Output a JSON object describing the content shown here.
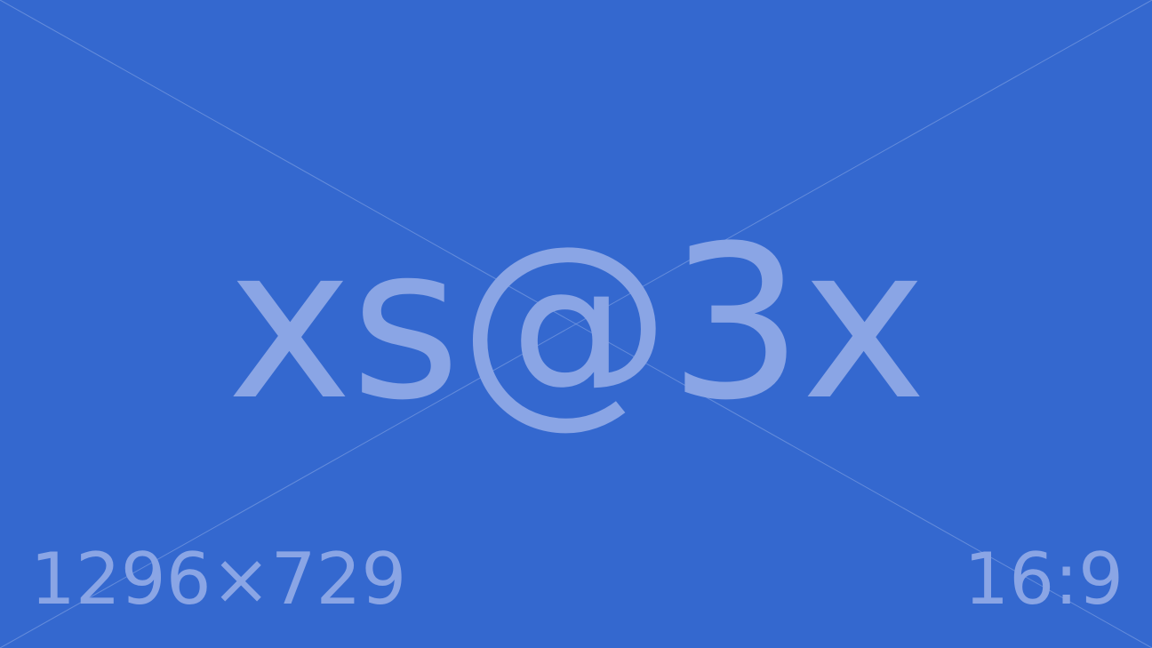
{
  "placeholder": {
    "label": "xs@3x",
    "dimensions": "1296×729",
    "aspect_ratio": "16:9"
  },
  "colors": {
    "background": "#3468CF",
    "text": "#8AA5E5"
  }
}
